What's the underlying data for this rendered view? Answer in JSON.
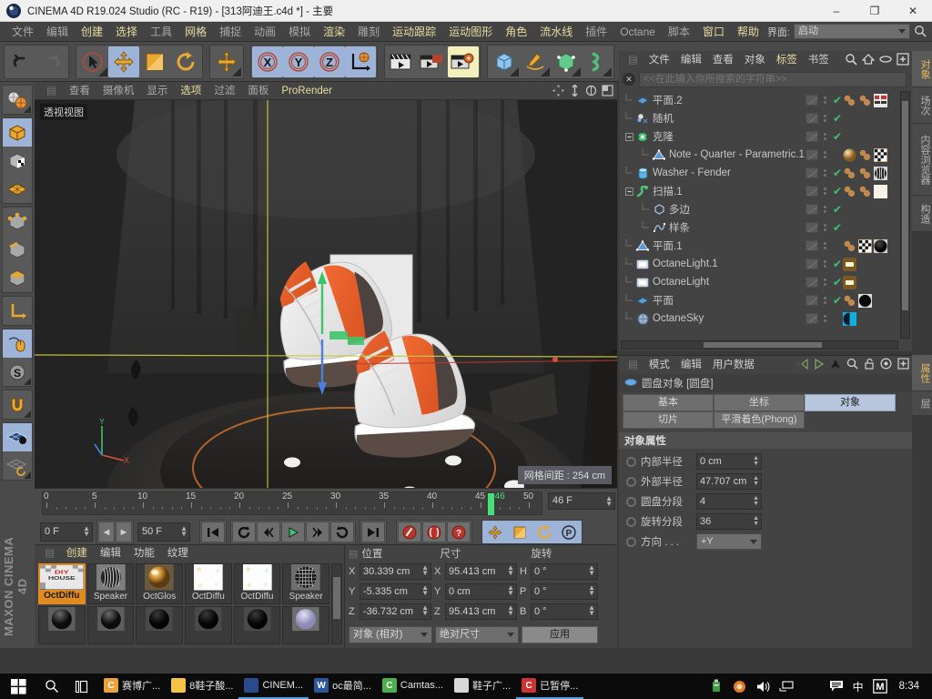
{
  "window": {
    "title": "CINEMA 4D R19.024 Studio (RC - R19) - [313阿迪王.c4d *] - 主要",
    "minimize": "–",
    "maximize": "❐",
    "close": "✕"
  },
  "menubar": {
    "items": [
      {
        "label": "文件",
        "hl": false
      },
      {
        "label": "编辑",
        "hl": false
      },
      {
        "label": "创建",
        "hl": true
      },
      {
        "label": "选择",
        "hl": true
      },
      {
        "label": "工具",
        "hl": false
      },
      {
        "label": "网格",
        "hl": true
      },
      {
        "label": "捕捉",
        "hl": false
      },
      {
        "label": "动画",
        "hl": false
      },
      {
        "label": "模拟",
        "hl": false
      },
      {
        "label": "渲染",
        "hl": true
      },
      {
        "label": "雕刻",
        "hl": false
      },
      {
        "label": "运动跟踪",
        "hl": true
      },
      {
        "label": "运动图形",
        "hl": true
      },
      {
        "label": "角色",
        "hl": true
      },
      {
        "label": "流水线",
        "hl": true
      },
      {
        "label": "插件",
        "hl": false
      },
      {
        "label": "Octane",
        "hl": false
      },
      {
        "label": "脚本",
        "hl": false
      },
      {
        "label": "窗口",
        "hl": true
      },
      {
        "label": "帮助",
        "hl": true
      }
    ],
    "interface_label": "界面:",
    "interface_value": "启动",
    "search_icon": "search-icon"
  },
  "viewport": {
    "menu": [
      {
        "label": "查看",
        "hl": false
      },
      {
        "label": "摄像机",
        "hl": false
      },
      {
        "label": "显示",
        "hl": false
      },
      {
        "label": "选项",
        "hl": true
      },
      {
        "label": "过滤",
        "hl": false
      },
      {
        "label": "面板",
        "hl": false
      },
      {
        "label": "ProRender",
        "hl": true
      }
    ],
    "view_label": "透视视图",
    "grid_info": "网格间距 : 254 cm",
    "axis_y": "Y",
    "axis_x": "X"
  },
  "timeline": {
    "ticks": [
      0,
      5,
      10,
      15,
      20,
      25,
      30,
      35,
      40,
      45,
      50
    ],
    "current_frame_marker": "46",
    "current_frame_field": "46 F",
    "start_field": "0 F",
    "end_field": "50 F",
    "max_frame": 50,
    "playhead_frame": 46,
    "buttons": [
      {
        "name": "goto-start-button",
        "glyph": "⏮"
      },
      {
        "name": "previous-key-button",
        "glyph": "↺"
      },
      {
        "name": "step-back-button",
        "glyph": "◄"
      },
      {
        "name": "play-button",
        "glyph": "▶"
      },
      {
        "name": "step-forward-button",
        "glyph": "►"
      },
      {
        "name": "next-key-button",
        "glyph": "↻"
      },
      {
        "name": "goto-end-button",
        "glyph": "⏭"
      },
      {
        "name": "record-button",
        "glyph": "●"
      },
      {
        "name": "autokey-button",
        "glyph": "◉"
      },
      {
        "name": "keyframe-help-button",
        "glyph": "?"
      }
    ],
    "lock_buttons": [
      {
        "name": "position-lock-button",
        "glyph": "✥"
      },
      {
        "name": "scale-lock-button",
        "glyph": "◨"
      },
      {
        "name": "rotation-lock-button",
        "glyph": "↻"
      },
      {
        "name": "pla-button",
        "glyph": "P"
      }
    ]
  },
  "material_manager": {
    "menu": [
      {
        "label": "创建",
        "hl": true
      },
      {
        "label": "编辑",
        "hl": false
      },
      {
        "label": "功能",
        "hl": false
      },
      {
        "label": "纹理",
        "hl": false
      }
    ],
    "materials": [
      {
        "name": "OctDiffu",
        "selected": true,
        "kind": "checker-texture"
      },
      {
        "name": "Speaker",
        "selected": false,
        "kind": "striped-sphere"
      },
      {
        "name": "OctGlos",
        "selected": false,
        "kind": "gold-sphere"
      },
      {
        "name": "OctDiffu",
        "selected": false,
        "kind": "white-texture"
      },
      {
        "name": "OctDiffu",
        "selected": false,
        "kind": "white-texture"
      },
      {
        "name": "Speaker",
        "selected": false,
        "kind": "mesh-sphere"
      },
      {
        "name": "",
        "selected": false,
        "kind": "dark-sphere"
      },
      {
        "name": "",
        "selected": false,
        "kind": "dark-sphere"
      },
      {
        "name": "",
        "selected": false,
        "kind": "black-sphere"
      },
      {
        "name": "",
        "selected": false,
        "kind": "black-sphere"
      },
      {
        "name": "",
        "selected": false,
        "kind": "black-sphere"
      },
      {
        "name": "",
        "selected": false,
        "kind": "lavender-sphere"
      }
    ]
  },
  "coordinates": {
    "headers": {
      "position": "位置",
      "size": "尺寸",
      "rotation": "旋转"
    },
    "rows": [
      {
        "pos_axis": "X",
        "pos_value": "30.339 cm",
        "size_axis": "X",
        "size_value": "95.413 cm",
        "rot_axis": "H",
        "rot_value": "0 °"
      },
      {
        "pos_axis": "Y",
        "pos_value": "-5.335 cm",
        "size_axis": "Y",
        "size_value": "0 cm",
        "rot_axis": "P",
        "rot_value": "0 °"
      },
      {
        "pos_axis": "Z",
        "pos_value": "-36.732 cm",
        "size_axis": "Z",
        "size_value": "95.413 cm",
        "rot_axis": "B",
        "rot_value": "0 °"
      }
    ],
    "mode_dropdown": "对象 (相对)",
    "size_dropdown": "绝对尺寸",
    "apply_button": "应用"
  },
  "object_manager": {
    "menu": [
      {
        "label": "文件",
        "hl": false
      },
      {
        "label": "编辑",
        "hl": false
      },
      {
        "label": "查看",
        "hl": false
      },
      {
        "label": "对象",
        "hl": false
      },
      {
        "label": "标签",
        "hl": true
      },
      {
        "label": "书签",
        "hl": false
      }
    ],
    "icons": [
      "search-icon",
      "home-icon",
      "ellipse-icon",
      "add-layer-icon"
    ],
    "search_placeholder": "<<在此输入你所搜索的字符串>>",
    "clear_icon": "close-icon",
    "objects": [
      {
        "name": "平面.2",
        "indent": 0,
        "icon": "plane-icon",
        "icon_color": "#5b9bd5",
        "expander": "",
        "check": true,
        "tags": [
          "#c08a4e",
          "#c08a4e",
          "texture"
        ]
      },
      {
        "name": "随机",
        "indent": 0,
        "icon": "random-icon",
        "icon_color": "#7fb3e0",
        "expander": "",
        "check": true,
        "tags": []
      },
      {
        "name": "克隆",
        "indent": 0,
        "icon": "cloner-icon",
        "icon_color": "#4fbf7a",
        "expander": "-",
        "check": true,
        "tags": []
      },
      {
        "name": "Note - Quarter - Parametric.1",
        "indent": 1,
        "icon": "polygon-icon",
        "icon_color": "#5b9bd5",
        "expander": "",
        "check": false,
        "tags": [
          "gold",
          "#c08a4e",
          "checker"
        ]
      },
      {
        "name": "Washer - Fender",
        "indent": 0,
        "icon": "cylinder-icon",
        "icon_color": "#5ab6e8",
        "expander": "",
        "check": true,
        "tags": [
          "#c08a4e",
          "#c08a4e",
          "striped"
        ]
      },
      {
        "name": "扫描.1",
        "indent": 0,
        "icon": "sweep-icon",
        "icon_color": "#4fbf7a",
        "expander": "-",
        "check": true,
        "tags": [
          "#c08a4e",
          "#c08a4e",
          "white"
        ]
      },
      {
        "name": "多边",
        "indent": 1,
        "icon": "ngon-icon",
        "icon_color": "#a8c8e8",
        "expander": "",
        "check": true,
        "tags": []
      },
      {
        "name": "样条",
        "indent": 1,
        "icon": "spline-icon",
        "icon_color": "#a8c8e8",
        "expander": "",
        "check": true,
        "tags": []
      },
      {
        "name": "平面.1",
        "indent": 0,
        "icon": "polygon-icon",
        "icon_color": "#5b9bd5",
        "expander": "",
        "check": false,
        "tags": [
          "#c08a4e",
          "checker",
          "black"
        ]
      },
      {
        "name": "OctaneLight.1",
        "indent": 0,
        "icon": "octanelight-icon",
        "icon_color": "#cfd8e6",
        "expander": "",
        "check": true,
        "tags": [
          "light"
        ]
      },
      {
        "name": "OctaneLight",
        "indent": 0,
        "icon": "octanelight-icon",
        "icon_color": "#cfd8e6",
        "expander": "",
        "check": true,
        "tags": [
          "light"
        ]
      },
      {
        "name": "平面",
        "indent": 0,
        "icon": "plane-icon",
        "icon_color": "#5b9bd5",
        "expander": "",
        "check": true,
        "tags": [
          "#c08a4e",
          "blackball"
        ]
      },
      {
        "name": "OctaneSky",
        "indent": 0,
        "icon": "sky-icon",
        "icon_color": "#9fb4cc",
        "expander": "",
        "check": false,
        "tags": [
          "cyan"
        ]
      }
    ]
  },
  "attributes": {
    "menu": [
      {
        "label": "模式",
        "hl": false
      },
      {
        "label": "编辑",
        "hl": false
      },
      {
        "label": "用户数据",
        "hl": false
      }
    ],
    "icons": [
      "back-arrow-icon",
      "forward-arrow-icon",
      "up-arrow-icon",
      "search-icon",
      "lock-icon",
      "target-icon",
      "add-icon"
    ],
    "object_title": "圆盘对象 [圆盘]",
    "tabs": [
      {
        "label": "基本",
        "active": false
      },
      {
        "label": "坐标",
        "active": false
      },
      {
        "label": "对象",
        "active": true
      },
      {
        "label": "切片",
        "active": false
      },
      {
        "label": "平滑着色(Phong)",
        "active": false
      }
    ],
    "section_title": "对象属性",
    "properties": [
      {
        "label": "内部半径",
        "value": "0 cm",
        "type": "field"
      },
      {
        "label": "外部半径",
        "value": "47.707 cm",
        "type": "field"
      },
      {
        "label": "圆盘分段",
        "value": "4",
        "type": "field"
      },
      {
        "label": "旋转分段",
        "value": "36",
        "type": "field"
      },
      {
        "label": "方向 . . .",
        "value": "+Y",
        "type": "dropdown"
      }
    ]
  },
  "right_tabs_top": [
    {
      "label": "对象",
      "active": true
    },
    {
      "label": "场次",
      "active": false
    },
    {
      "label": "内容浏览器",
      "active": false
    },
    {
      "label": "构造",
      "active": false
    }
  ],
  "right_tabs_bottom": [
    {
      "label": "属性",
      "active": true
    },
    {
      "label": "层",
      "active": false
    }
  ],
  "left_toolbar": [
    {
      "name": "undo-button",
      "glyph": "↶",
      "selected": false
    },
    {
      "name": "live-selection-button",
      "glyph": "cursor",
      "selected": false
    },
    {
      "name": "move-button",
      "glyph": "✥",
      "selected": true
    },
    {
      "name": "scale-button",
      "glyph": "◨",
      "selected": false
    },
    {
      "name": "rotate-button",
      "glyph": "↻",
      "selected": false
    }
  ],
  "left_icons": [
    {
      "name": "render-view-button",
      "selected": false
    },
    {
      "name": "make-editable-button",
      "selected": true
    },
    {
      "name": "model-mode-button",
      "selected": false
    },
    {
      "name": "texture-mode-button",
      "selected": false
    },
    {
      "name": "points-mode-button",
      "selected": false
    },
    {
      "name": "edges-mode-button",
      "selected": false
    },
    {
      "name": "polygons-mode-button",
      "selected": false
    },
    {
      "name": "axis-mode-button",
      "selected": false
    },
    {
      "name": "viewport-solo-button",
      "selected": true
    },
    {
      "name": "snap-button",
      "selected": true
    },
    {
      "name": "workplane-button",
      "selected": false
    },
    {
      "name": "lock-workplane-button",
      "selected": true
    },
    {
      "name": "planar-workplane-button",
      "selected": false
    }
  ],
  "branding": "MAXON CINEMA 4D",
  "taskbar": {
    "start_icon": "windows-start-icon",
    "search_icon": "search-icon",
    "taskview_icon": "task-view-icon",
    "apps": [
      {
        "label": "赛博广...",
        "color": "#e8a33d",
        "letter": "C",
        "active": false
      },
      {
        "label": "8鞋子酸...",
        "color": "#f3c34a",
        "letter": "",
        "active": false
      },
      {
        "label": "CINEM...",
        "color": "#2b4a8b",
        "letter": "",
        "active": true
      },
      {
        "label": "oc最简...",
        "color": "#2b579a",
        "letter": "W",
        "active": false
      },
      {
        "label": "Camtas...",
        "color": "#4cae4c",
        "letter": "C",
        "active": false
      },
      {
        "label": "鞋子广...",
        "color": "#d8d8d8",
        "letter": "",
        "active": false
      },
      {
        "label": "已暂停...",
        "color": "#cc3333",
        "letter": "C",
        "active": true
      }
    ],
    "tray": [
      {
        "name": "usb-icon"
      },
      {
        "name": "app-tray-icon"
      },
      {
        "name": "volume-icon"
      },
      {
        "name": "network-icon"
      }
    ],
    "notification_icon": "notification-icon",
    "ime_label": "中",
    "ime_icon": "M",
    "clock": "8:34"
  }
}
